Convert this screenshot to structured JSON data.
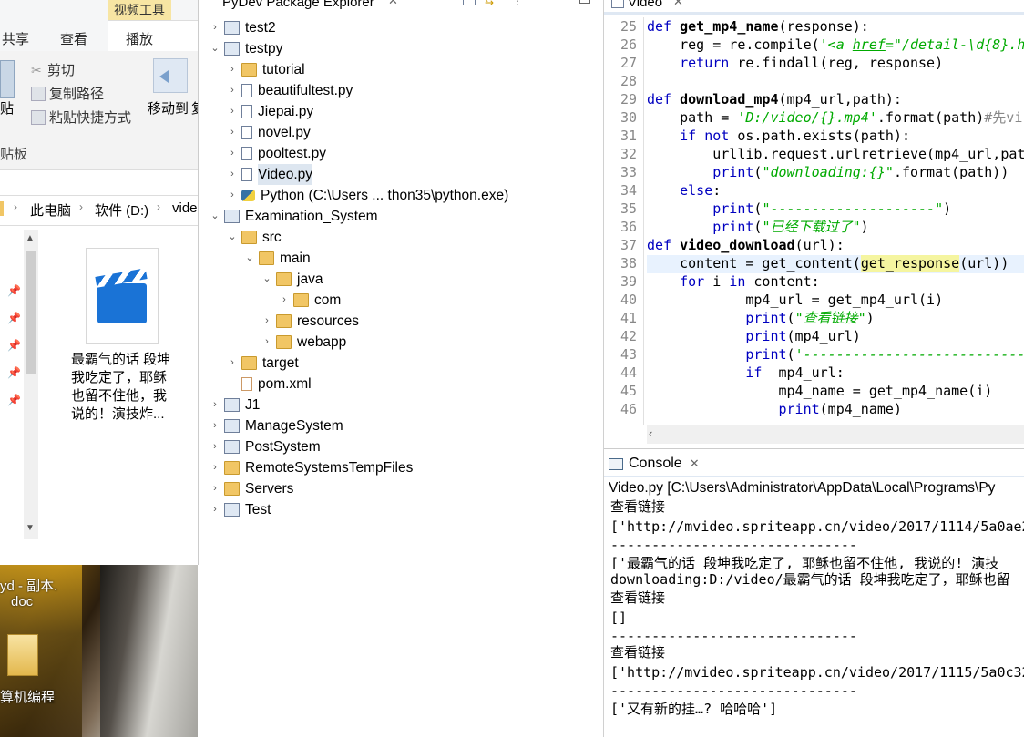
{
  "explorer": {
    "ribbon_context_tab": "视频工具",
    "tabs": [
      "共享",
      "查看",
      "播放"
    ],
    "clipboard": {
      "paste": "贴",
      "cut": "剪切",
      "copy_path": "复制路径",
      "paste_shortcut": "粘贴快捷方式",
      "move_to": "移动到",
      "move_to_cut": "复",
      "group_label": "贴板"
    },
    "breadcrumb": [
      "此电脑",
      "软件 (D:)",
      "vide"
    ],
    "file": {
      "name": "最霸气的话 段坤我吃定了，耶稣也留不住他，我说的！演技炸..."
    },
    "desktop": {
      "item1": "yd - 副本.",
      "item1b": "doc",
      "item2": "算机编程"
    }
  },
  "package_explorer": {
    "title": "PyDev Package Explorer",
    "items": [
      {
        "label": "test2"
      },
      {
        "label": "testpy"
      },
      {
        "label": "tutorial"
      },
      {
        "label": "beautifultest.py"
      },
      {
        "label": "Jiepai.py"
      },
      {
        "label": "novel.py"
      },
      {
        "label": "pooltest.py"
      },
      {
        "label": "Video.py"
      },
      {
        "label": "Python  (C:\\Users ... thon35\\python.exe)"
      },
      {
        "label": "Examination_System"
      },
      {
        "label": "src"
      },
      {
        "label": "main"
      },
      {
        "label": "java"
      },
      {
        "label": "com"
      },
      {
        "label": "resources"
      },
      {
        "label": "webapp"
      },
      {
        "label": "target"
      },
      {
        "label": "pom.xml"
      },
      {
        "label": "J1"
      },
      {
        "label": "ManageSystem"
      },
      {
        "label": "PostSystem"
      },
      {
        "label": "RemoteSystemsTempFiles"
      },
      {
        "label": "Servers"
      },
      {
        "label": "Test"
      }
    ]
  },
  "editor": {
    "tab_title": "Video",
    "lines": [
      {
        "n": "25",
        "t": "def get_mp4_name(response):"
      },
      {
        "n": "26",
        "t": "    reg = re.compile('<a href=\"/detail-\\d{8}.h"
      },
      {
        "n": "27",
        "t": "    return re.findall(reg, response)"
      },
      {
        "n": "28",
        "t": ""
      },
      {
        "n": "29",
        "t": "def download_mp4(mp4_url,path):"
      },
      {
        "n": "30",
        "t": "    path = 'D:/video/{}.mp4'.format(path)#先vi"
      },
      {
        "n": "31",
        "t": "    if not os.path.exists(path):"
      },
      {
        "n": "32",
        "t": "        urllib.request.urlretrieve(mp4_url,pat"
      },
      {
        "n": "33",
        "t": "        print(\"downloading:{}\".format(path))"
      },
      {
        "n": "34",
        "t": "    else:"
      },
      {
        "n": "35",
        "t": "        print(\"--------------------\")"
      },
      {
        "n": "36",
        "t": "        print(\"已经下载过了\")"
      },
      {
        "n": "37",
        "t": "def video_download(url):"
      },
      {
        "n": "38",
        "t": "    content = get_content(get_response(url))"
      },
      {
        "n": "39",
        "t": "    for i in content:"
      },
      {
        "n": "40",
        "t": "            mp4_url = get_mp4_url(i)"
      },
      {
        "n": "41",
        "t": "            print(\"查看链接\")"
      },
      {
        "n": "42",
        "t": "            print(mp4_url)"
      },
      {
        "n": "43",
        "t": "            print('------------------------------"
      },
      {
        "n": "44",
        "t": "            if  mp4_url:"
      },
      {
        "n": "45",
        "t": "                mp4_name = get_mp4_name(i)"
      },
      {
        "n": "46",
        "t": "                print(mp4_name)"
      }
    ]
  },
  "console": {
    "tab_title": "Console",
    "header": "Video.py [C:\\Users\\Administrator\\AppData\\Local\\Programs\\Py",
    "lines": [
      "查看链接",
      "['http://mvideo.spriteapp.cn/video/2017/1114/5a0ae2",
      "------------------------------",
      "['最霸气的话 段坤我吃定了, 耶稣也留不住他, 我说的! 演技",
      "downloading:D:/video/最霸气的话 段坤我吃定了，耶稣也留",
      "查看链接",
      "[]",
      "------------------------------",
      "查看链接",
      "['http://mvideo.spriteapp.cn/video/2017/1115/5a0c32",
      "------------------------------",
      "['又有新的挂…? 哈哈哈']"
    ]
  }
}
